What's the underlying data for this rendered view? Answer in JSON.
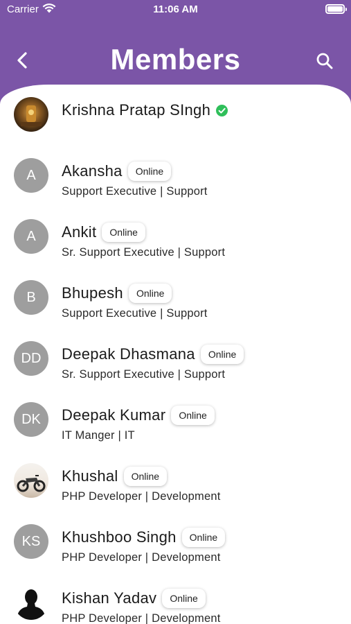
{
  "status_bar": {
    "carrier": "Carrier",
    "time": "11:06 AM"
  },
  "header": {
    "title": "Members",
    "back_icon": "chevron-left-icon",
    "search_icon": "search-icon",
    "background_color": "#7b55a7"
  },
  "members": [
    {
      "name": "Krishna Pratap SIngh",
      "verified": true,
      "online_label": "",
      "role": "",
      "avatar_initials": "",
      "avatar_type": "photo-temple"
    },
    {
      "name": "Akansha",
      "verified": false,
      "online_label": "Online",
      "role": "Support Executive | Support",
      "avatar_initials": "A",
      "avatar_type": "initials"
    },
    {
      "name": "Ankit",
      "verified": false,
      "online_label": "Online",
      "role": "Sr. Support Executive | Support",
      "avatar_initials": "A",
      "avatar_type": "initials"
    },
    {
      "name": "Bhupesh",
      "verified": false,
      "online_label": "Online",
      "role": "Support Executive | Support",
      "avatar_initials": "B",
      "avatar_type": "initials"
    },
    {
      "name": "Deepak Dhasmana",
      "verified": false,
      "online_label": "Online",
      "role": "Sr. Support Executive | Support",
      "avatar_initials": "DD",
      "avatar_type": "initials"
    },
    {
      "name": "Deepak Kumar",
      "verified": false,
      "online_label": "Online",
      "role": "IT Manger | IT",
      "avatar_initials": "DK",
      "avatar_type": "initials"
    },
    {
      "name": "Khushal",
      "verified": false,
      "online_label": "Online",
      "role": "PHP Developer | Development",
      "avatar_initials": "",
      "avatar_type": "photo-bike"
    },
    {
      "name": "Khushboo Singh",
      "verified": false,
      "online_label": "Online",
      "role": "PHP Developer | Development",
      "avatar_initials": "KS",
      "avatar_type": "initials"
    },
    {
      "name": "Kishan Yadav",
      "verified": false,
      "online_label": "Online",
      "role": "PHP Developer | Development",
      "avatar_initials": "",
      "avatar_type": "photo-silhouette"
    }
  ]
}
